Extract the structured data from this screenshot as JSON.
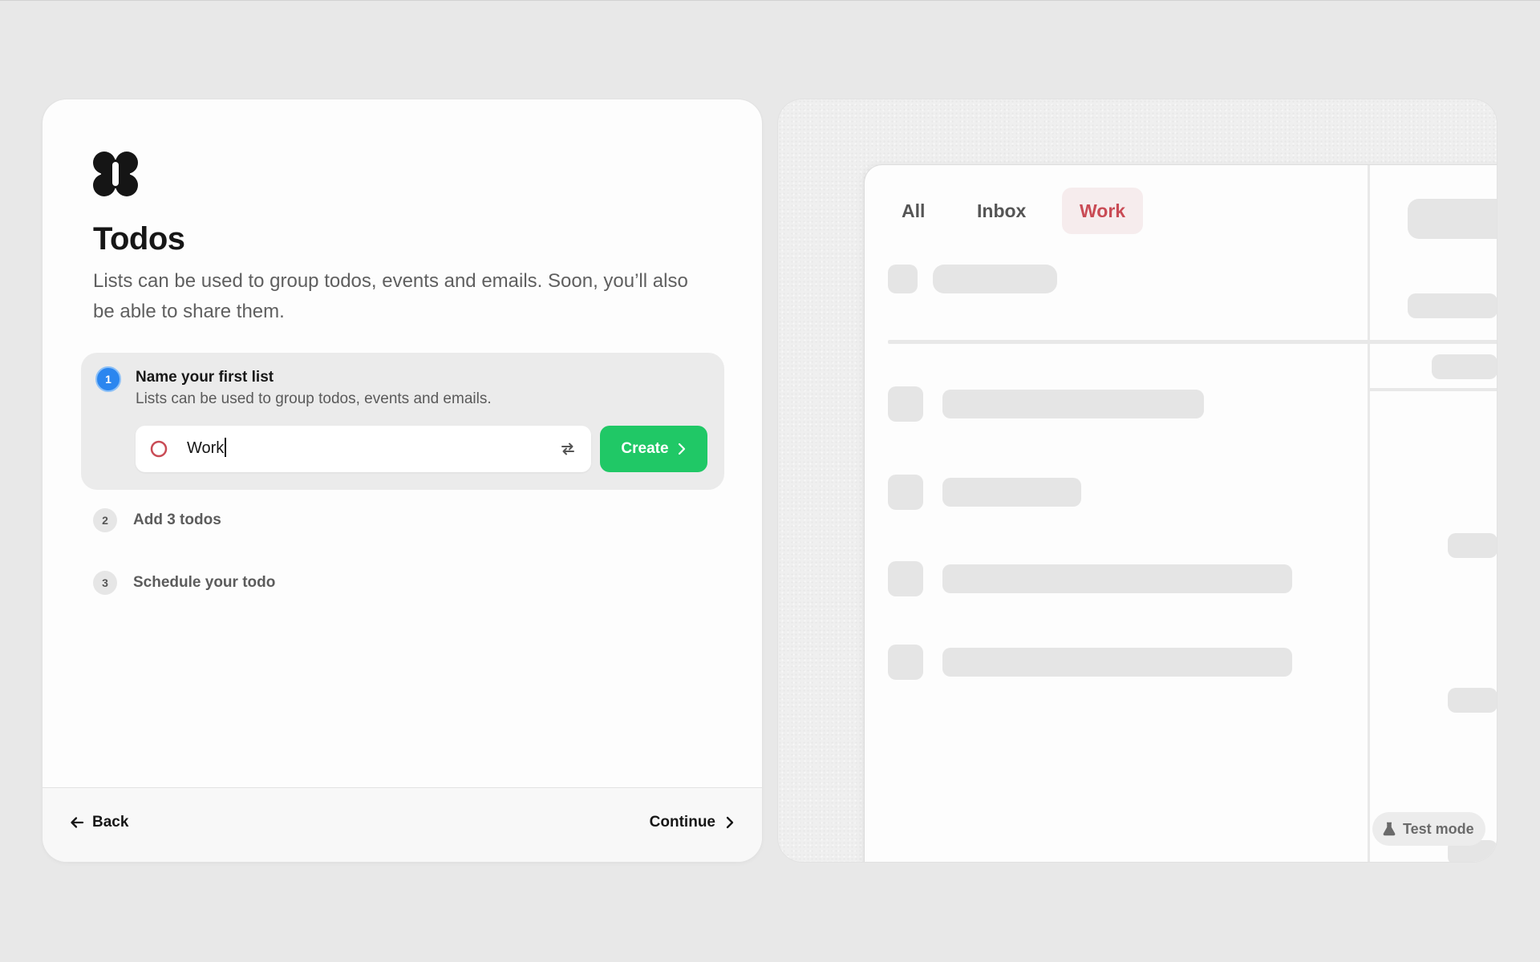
{
  "onboarding": {
    "app_title": "Todos",
    "description": "Lists can be used to group todos, events and emails. Soon, you’ll also be able to share them.",
    "steps": [
      {
        "number": "1",
        "title": "Name your first list",
        "description": "Lists can be used to group todos, events and emails."
      },
      {
        "number": "2",
        "title": "Add 3 todos"
      },
      {
        "number": "3",
        "title": "Schedule your todo"
      }
    ],
    "list_name_input": {
      "value": "Work"
    },
    "create_label": "Create",
    "back_label": "Back",
    "continue_label": "Continue"
  },
  "preview": {
    "tabs": [
      {
        "label": "All",
        "active": false
      },
      {
        "label": "Inbox",
        "active": false
      },
      {
        "label": "Work",
        "active": true
      }
    ],
    "test_mode_label": "Test mode"
  },
  "colors": {
    "accent_blue": "#2b86ef",
    "create_green": "#20c866",
    "work_red": "#c94b55",
    "background": "#e8e8e8"
  },
  "icons": [
    "app-logo",
    "circle-outline-icon",
    "swap-icon",
    "chevron-right-icon",
    "arrow-left-icon",
    "flask-icon"
  ]
}
